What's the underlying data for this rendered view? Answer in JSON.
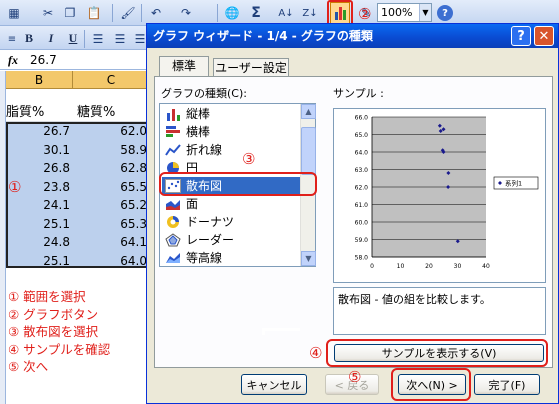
{
  "toolbar": {
    "zoom_value": "100%",
    "icons": [
      "grid-icon",
      "cut-icon",
      "copy-icon",
      "paste-icon",
      "format-painter-icon",
      "undo-icon",
      "redo-icon",
      "hyperlink-icon",
      "sum-icon",
      "sort-ascending-icon",
      "sort-descending-icon",
      "chart-wizard-icon",
      "drawing-icon",
      "help-icon"
    ],
    "sum_glyph": "Σ"
  },
  "format_toolbar": {
    "bold": "B",
    "italic": "I",
    "underline": "U"
  },
  "formula_bar": {
    "fx": "fx",
    "value": "26.7"
  },
  "sheet": {
    "columns": [
      "B",
      "C"
    ],
    "headers": [
      "脂質%",
      "糖質%"
    ],
    "rows": [
      [
        "26.7",
        "62.0"
      ],
      [
        "30.1",
        "58.9"
      ],
      [
        "26.8",
        "62.8"
      ],
      [
        "23.8",
        "65.5"
      ],
      [
        "24.1",
        "65.2"
      ],
      [
        "25.1",
        "65.3"
      ],
      [
        "24.8",
        "64.1"
      ],
      [
        "25.1",
        "64.0"
      ]
    ],
    "selection_color": "#bcd0ed"
  },
  "dialog": {
    "title": "グラフ ウィザード - 1/4 - グラフの種類",
    "help_glyph": "?",
    "close_glyph": "✕",
    "tabs": [
      "標準",
      "ユーザー設定"
    ],
    "chart_type_label": "グラフの種類(C):",
    "chart_types": [
      {
        "label": "縦棒",
        "icon": "column-chart-icon"
      },
      {
        "label": "横棒",
        "icon": "bar-chart-icon"
      },
      {
        "label": "折れ線",
        "icon": "line-chart-icon"
      },
      {
        "label": "円",
        "icon": "pie-chart-icon"
      },
      {
        "label": "散布図",
        "icon": "scatter-chart-icon",
        "selected": true
      },
      {
        "label": "面",
        "icon": "area-chart-icon"
      },
      {
        "label": "ドーナツ",
        "icon": "doughnut-chart-icon"
      },
      {
        "label": "レーダー",
        "icon": "radar-chart-icon"
      },
      {
        "label": "等高線",
        "icon": "surface-chart-icon"
      }
    ],
    "sample_label": "サンプル :",
    "description": "散布図 - 値の組を比較します。",
    "buttons": {
      "preview": "サンプルを表示する(V)",
      "cancel": "キャンセル",
      "back": "< 戻る",
      "next": "次へ(N) >",
      "finish": "完了(F)"
    }
  },
  "chart_data": {
    "type": "scatter",
    "series": [
      {
        "name": "系列1",
        "points": [
          [
            26.7,
            62.0
          ],
          [
            30.1,
            58.9
          ],
          [
            26.8,
            62.8
          ],
          [
            23.8,
            65.5
          ],
          [
            24.1,
            65.2
          ],
          [
            25.1,
            65.3
          ],
          [
            24.8,
            64.1
          ],
          [
            25.1,
            64.0
          ]
        ],
        "color": "#1a1a8c"
      }
    ],
    "xlim": [
      0,
      40
    ],
    "ylim": [
      58.0,
      66.0
    ],
    "x_ticks": [
      "0",
      "10",
      "20",
      "30",
      "40"
    ],
    "y_ticks": [
      "66.0",
      "65.0",
      "64.0",
      "63.0",
      "62.0",
      "61.0",
      "60.0",
      "59.0",
      "58.0"
    ],
    "plot_background": "#c0c0c0",
    "grid": true,
    "legend_position": "right"
  },
  "annotations": {
    "markers": [
      "①",
      "②",
      "③",
      "④",
      "⑤"
    ],
    "steps": [
      "① 範囲を選択",
      "② グラフボタン",
      "③ 散布図を選択",
      "④ サンプルを確認",
      "⑤ 次へ"
    ],
    "color": "#e0201b"
  }
}
